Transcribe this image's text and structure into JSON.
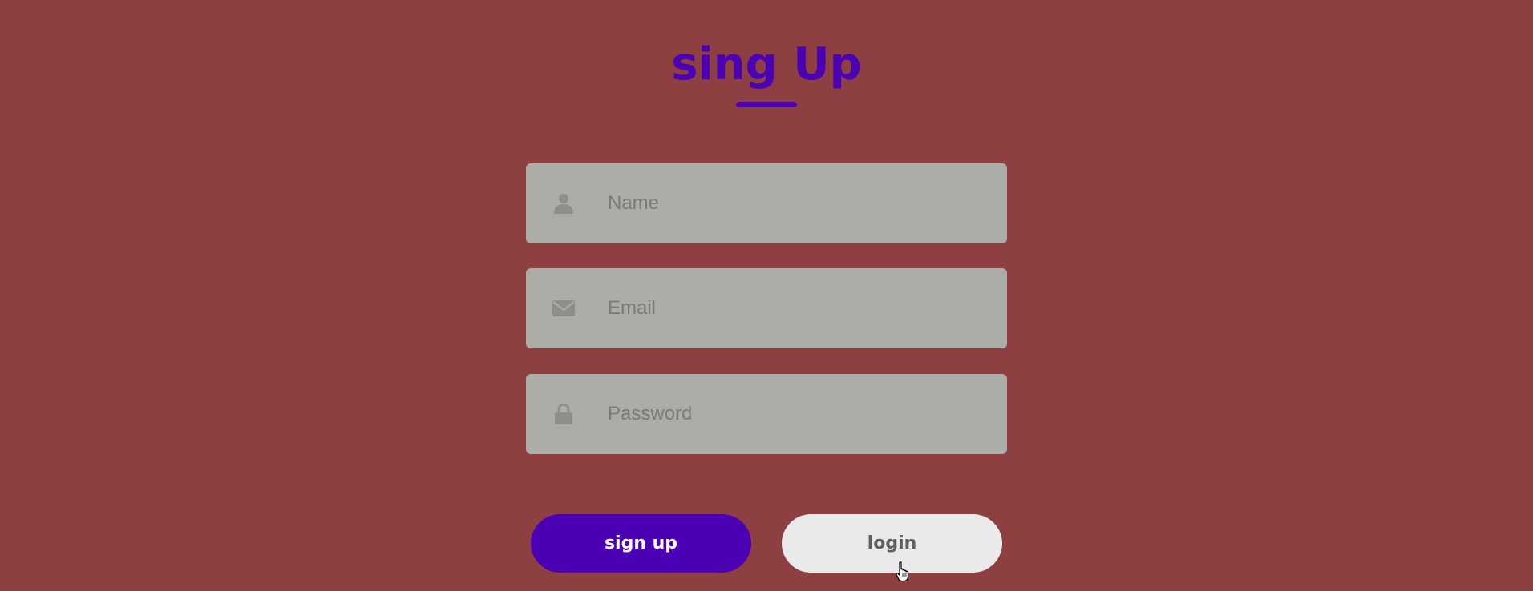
{
  "header": {
    "title": "sing Up"
  },
  "form": {
    "name": {
      "placeholder": "Name",
      "value": "",
      "icon": "user-icon"
    },
    "email": {
      "placeholder": "Email",
      "value": "",
      "icon": "envelope-icon"
    },
    "password": {
      "placeholder": "Password",
      "value": "",
      "icon": "lock-icon"
    }
  },
  "actions": {
    "signup_label": "sign up",
    "login_label": "login"
  },
  "colors": {
    "background": "#8e3f42",
    "accent": "#4b00b3",
    "field_bg": "#adada8",
    "secondary_button": "#eaeaea"
  }
}
